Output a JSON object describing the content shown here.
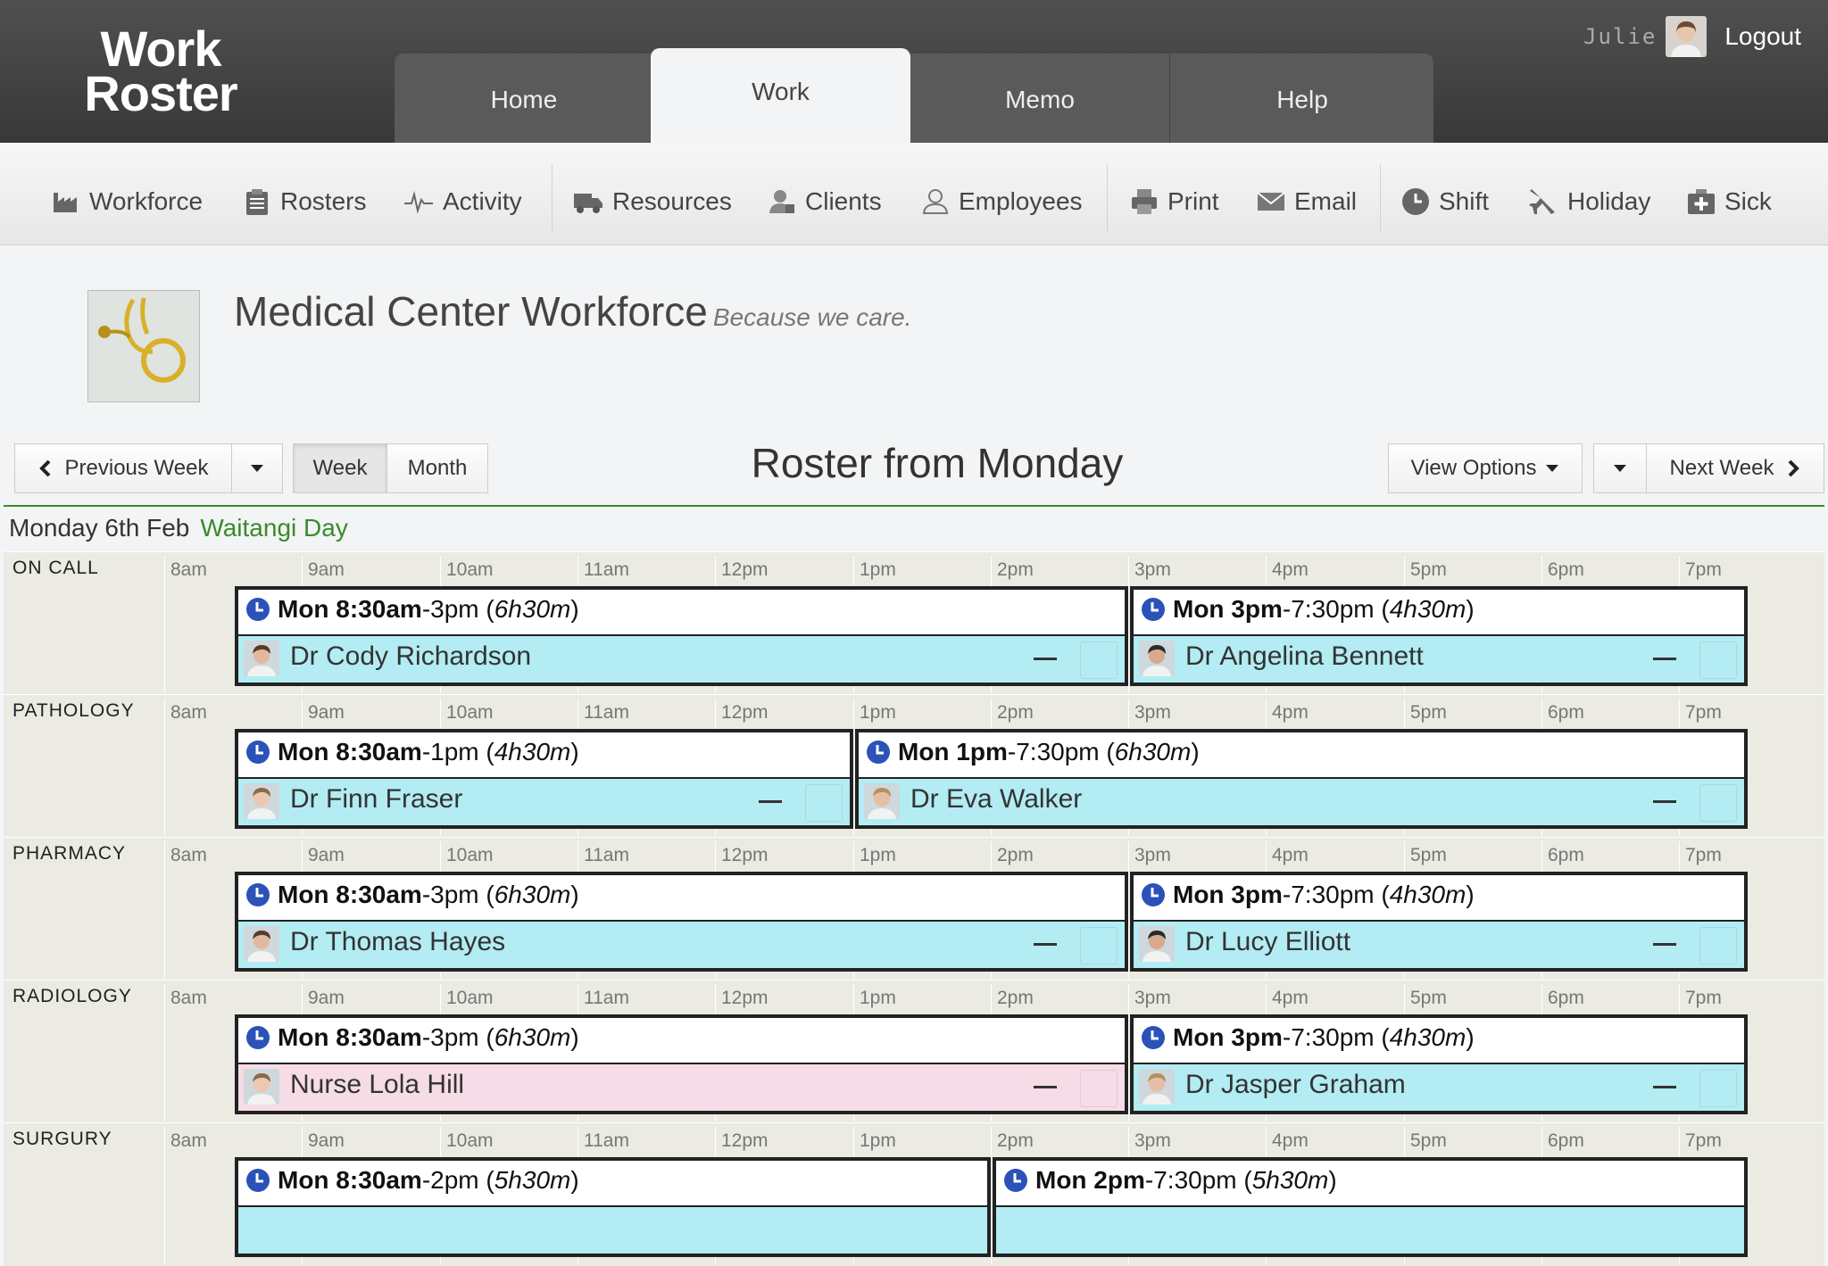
{
  "header": {
    "logo_line1": "Work",
    "logo_line2": "Roster",
    "tabs": [
      {
        "label": "Home"
      },
      {
        "label": "Work"
      },
      {
        "label": "Memo"
      },
      {
        "label": "Help"
      }
    ],
    "active_tab": "Work",
    "username": "Julie",
    "logout": "Logout"
  },
  "toolbar": {
    "items": [
      {
        "label": "Workforce",
        "icon": "factory-icon"
      },
      {
        "label": "Rosters",
        "icon": "clipboard-icon"
      },
      {
        "label": "Activity",
        "icon": "pulse-icon"
      },
      {
        "label": "Resources",
        "icon": "truck-icon"
      },
      {
        "label": "Clients",
        "icon": "client-icon"
      },
      {
        "label": "Employees",
        "icon": "user-icon"
      },
      {
        "label": "Print",
        "icon": "printer-icon"
      },
      {
        "label": "Email",
        "icon": "envelope-icon"
      },
      {
        "label": "Shift",
        "icon": "clock-icon"
      },
      {
        "label": "Holiday",
        "icon": "plane-icon"
      },
      {
        "label": "Sick",
        "icon": "first-aid-icon"
      }
    ]
  },
  "page": {
    "title": "Medical Center Workforce",
    "tagline": "Because we care."
  },
  "controls": {
    "previous_week": "Previous Week",
    "week": "Week",
    "month": "Month",
    "roster_title": "Roster from Monday",
    "view_options": "View Options",
    "next_week": "Next Week",
    "selected_view": "Week"
  },
  "day": {
    "label": "Monday 6th Feb",
    "holiday": "Waitangi Day"
  },
  "hours": [
    "8am",
    "9am",
    "10am",
    "11am",
    "12pm",
    "1pm",
    "2pm",
    "3pm",
    "4pm",
    "5pm",
    "6pm",
    "7pm"
  ],
  "sections": [
    {
      "name": "ON CALL",
      "shifts": [
        {
          "start": "Mon 8:30am",
          "end": "-3pm",
          "duration": "6h30m",
          "person": "Dr Cody Richardson",
          "type": "blue"
        },
        {
          "start": "Mon 3pm",
          "end": "-7:30pm",
          "duration": "4h30m",
          "person": "Dr Angelina Bennett",
          "type": "blue"
        }
      ]
    },
    {
      "name": "PATHOLOGY",
      "shifts": [
        {
          "start": "Mon 8:30am",
          "end": "-1pm",
          "duration": "4h30m",
          "person": "Dr Finn Fraser",
          "type": "blue"
        },
        {
          "start": "Mon 1pm",
          "end": "-7:30pm",
          "duration": "6h30m",
          "person": "Dr Eva Walker",
          "type": "blue"
        }
      ]
    },
    {
      "name": "PHARMACY",
      "shifts": [
        {
          "start": "Mon 8:30am",
          "end": "-3pm",
          "duration": "6h30m",
          "person": "Dr Thomas Hayes",
          "type": "blue"
        },
        {
          "start": "Mon 3pm",
          "end": "-7:30pm",
          "duration": "4h30m",
          "person": "Dr Lucy Elliott",
          "type": "blue"
        }
      ]
    },
    {
      "name": "RADIOLOGY",
      "shifts": [
        {
          "start": "Mon 8:30am",
          "end": "-3pm",
          "duration": "6h30m",
          "person": "Nurse Lola Hill",
          "type": "pink"
        },
        {
          "start": "Mon 3pm",
          "end": "-7:30pm",
          "duration": "4h30m",
          "person": "Dr Jasper Graham",
          "type": "blue"
        }
      ]
    },
    {
      "name": "SURGURY",
      "shifts": [
        {
          "start": "Mon 8:30am",
          "end": "-2pm",
          "duration": "5h30m",
          "person": "",
          "type": "blue"
        },
        {
          "start": "Mon 2pm",
          "end": "-7:30pm",
          "duration": "5h30m",
          "person": "",
          "type": "blue"
        }
      ]
    }
  ],
  "colors": {
    "header_bg": "#3f3f3f",
    "accent_green": "#3a8a2a",
    "shift_blue": "#b3ecf3",
    "shift_pink": "#f5dce6",
    "clock_blue": "#2a52b8"
  }
}
